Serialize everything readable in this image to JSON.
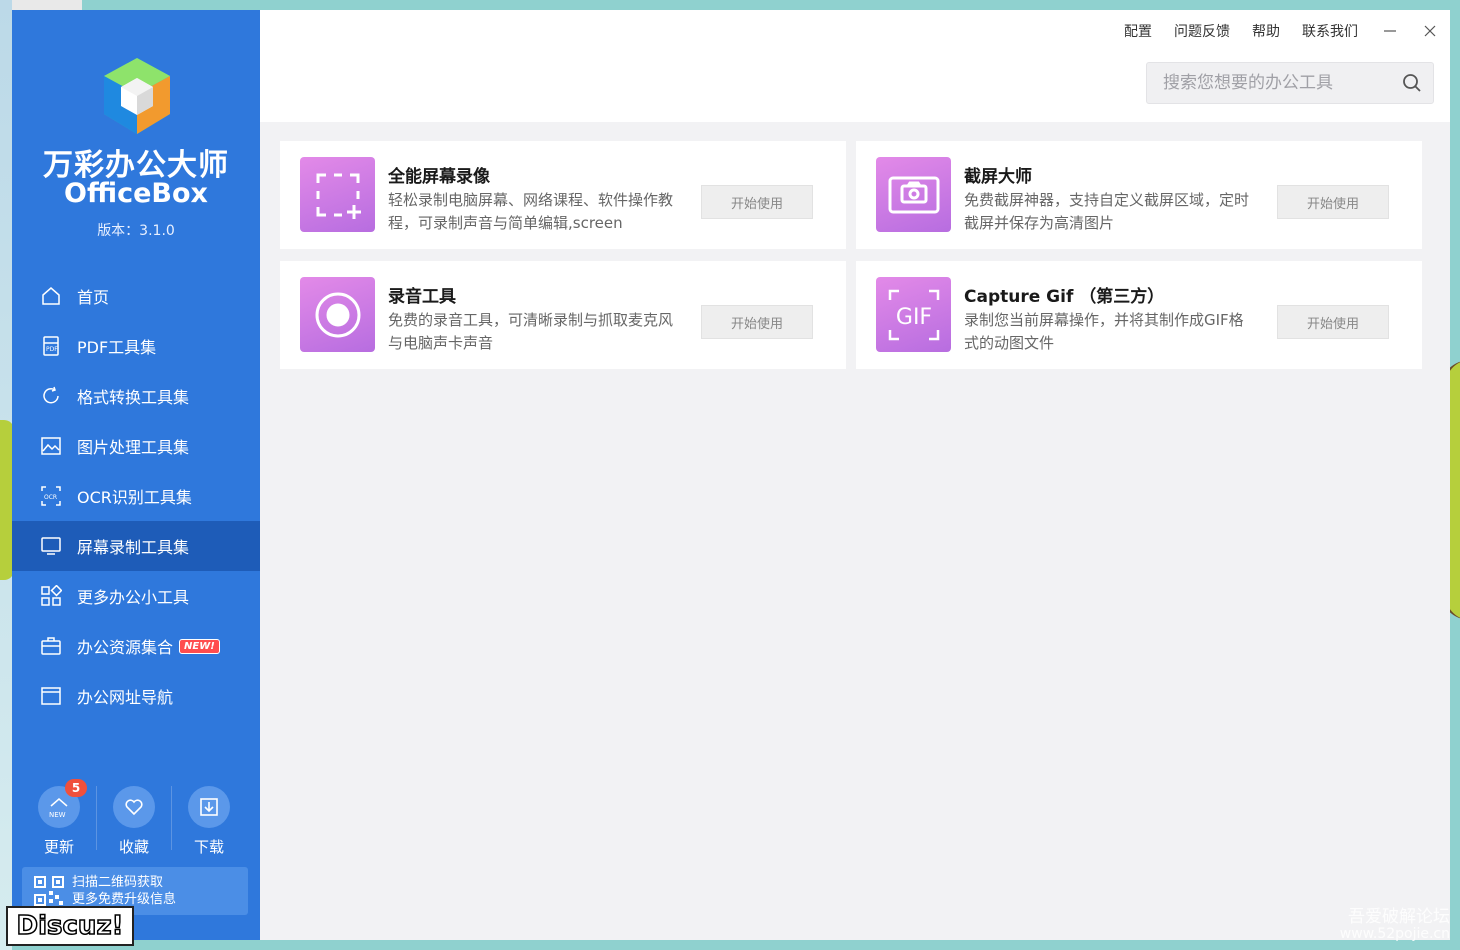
{
  "app": {
    "name_cn": "万彩办公大师",
    "name_en": "OfficeBox",
    "version": "版本：3.1.0"
  },
  "colors": {
    "sidebar": "#2f78dc",
    "sidebar_active": "#1e5cb8",
    "tool_icon_gradient_start": "#e38ae8",
    "tool_icon_gradient_end": "#b76de0"
  },
  "nav": {
    "items": [
      {
        "label": "首页",
        "icon": "home-icon"
      },
      {
        "label": "PDF工具集",
        "icon": "pdf-icon"
      },
      {
        "label": "格式转换工具集",
        "icon": "convert-icon"
      },
      {
        "label": "图片处理工具集",
        "icon": "image-icon"
      },
      {
        "label": "OCR识别工具集",
        "icon": "ocr-icon"
      },
      {
        "label": "屏幕录制工具集",
        "icon": "monitor-icon",
        "active": true
      },
      {
        "label": "更多办公小工具",
        "icon": "grid-icon"
      },
      {
        "label": "办公资源集合",
        "icon": "briefcase-icon",
        "badge": "NEW!"
      },
      {
        "label": "办公网址导航",
        "icon": "browser-icon"
      }
    ]
  },
  "bottom": {
    "update": {
      "label": "更新",
      "badge": "5",
      "icon_text": "NEW"
    },
    "favorite": {
      "label": "收藏"
    },
    "download": {
      "label": "下载"
    },
    "qr_text_1": "扫描二维码获取",
    "qr_text_2": "更多免费升级信息"
  },
  "topmenu": {
    "config": "配置",
    "feedback": "问题反馈",
    "help": "帮助",
    "contact": "联系我们"
  },
  "search": {
    "placeholder": "搜索您想要的办公工具"
  },
  "tools": [
    {
      "title": "全能屏幕录像",
      "desc": "轻松录制电脑屏幕、网络课程、软件操作教程，可录制声音与简单编辑,screen",
      "button": "开始使用",
      "icon": "screen-record-icon"
    },
    {
      "title": "截屏大师",
      "desc": "免费截屏神器，支持自定义截屏区域，定时截屏并保存为高清图片",
      "button": "开始使用",
      "icon": "screenshot-icon"
    },
    {
      "title": "录音工具",
      "desc": "免费的录音工具，可清晰录制与抓取麦克风与电脑声卡声音",
      "button": "开始使用",
      "icon": "record-icon"
    },
    {
      "title": "Capture Gif （第三方）",
      "desc": "录制您当前屏幕操作，并将其制作成GIF格式的动图文件",
      "button": "开始使用",
      "icon": "gif-icon",
      "icon_text": "GIF"
    }
  ],
  "watermark": {
    "discuz": "Discuz!",
    "site_cn": "吾爱破解论坛",
    "site_url": "www.52pojie.cn"
  }
}
